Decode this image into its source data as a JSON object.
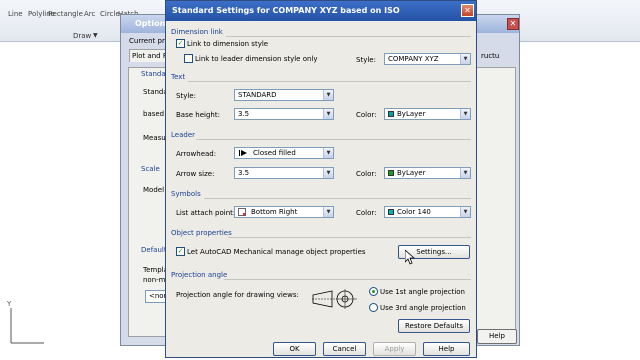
{
  "ribbon": {
    "tools": [
      "Line",
      "Polyline",
      "Rectangle",
      "Arc",
      "Circle",
      "Hatch"
    ],
    "draw_label": "Draw"
  },
  "options_dialog": {
    "title": "Options",
    "current_profile_label": "Current profi",
    "tab_label": "Plot and Fi",
    "standard_label": "Standar",
    "standard_text": "Standard",
    "based_label": "based",
    "measure_label": "Measu",
    "scale_label": "Scale",
    "model_label": "Model",
    "default_label": "Default",
    "template_label": "Templa",
    "nonm_label": "non-m",
    "input_value": "<non",
    "help_label": "Help",
    "right_cut_label": "ructu"
  },
  "dialog": {
    "title": "Standard Settings for COMPANY XYZ based on ISO",
    "sections": {
      "dimension_link": "Dimension link",
      "text": "Text",
      "leader": "Leader",
      "symbols": "Symbols",
      "object_properties": "Object properties",
      "projection_angle": "Projection angle"
    },
    "dimension_link": {
      "link_dim_style": "Link to dimension style",
      "link_leader_style": "Link to leader dimension style only",
      "style_label": "Style:",
      "style_value": "COMPANY XYZ"
    },
    "text": {
      "style_label": "Style:",
      "style_value": "STANDARD",
      "base_height_label": "Base height:",
      "base_height_value": "3.5",
      "color_label": "Color:",
      "color_value": "ByLayer"
    },
    "leader": {
      "arrowhead_label": "Arrowhead:",
      "arrowhead_value": "Closed filled",
      "arrow_size_label": "Arrow size:",
      "arrow_size_value": "3.5",
      "color_label": "Color:",
      "color_value": "ByLayer"
    },
    "symbols": {
      "attach_label": "List attach point:",
      "attach_value": "Bottom Right",
      "color_label": "Color:",
      "color_value": "Color 140"
    },
    "object_properties": {
      "manage_label": "Let AutoCAD Mechanical manage object properties",
      "settings_button": "Settings..."
    },
    "projection": {
      "label": "Projection angle for drawing views:",
      "first_angle": "Use 1st angle projection",
      "third_angle": "Use 3rd angle projection",
      "restore_button": "Restore Defaults"
    },
    "buttons": {
      "ok": "OK",
      "cancel": "Cancel",
      "apply": "Apply",
      "help": "Help"
    }
  },
  "colors": {
    "text_color_swatch": "#00a0a0",
    "leader_color_swatch": "#1a9a1a",
    "symbols_color_swatch": "#00b4b4",
    "section_heading": "#1c3f94"
  }
}
